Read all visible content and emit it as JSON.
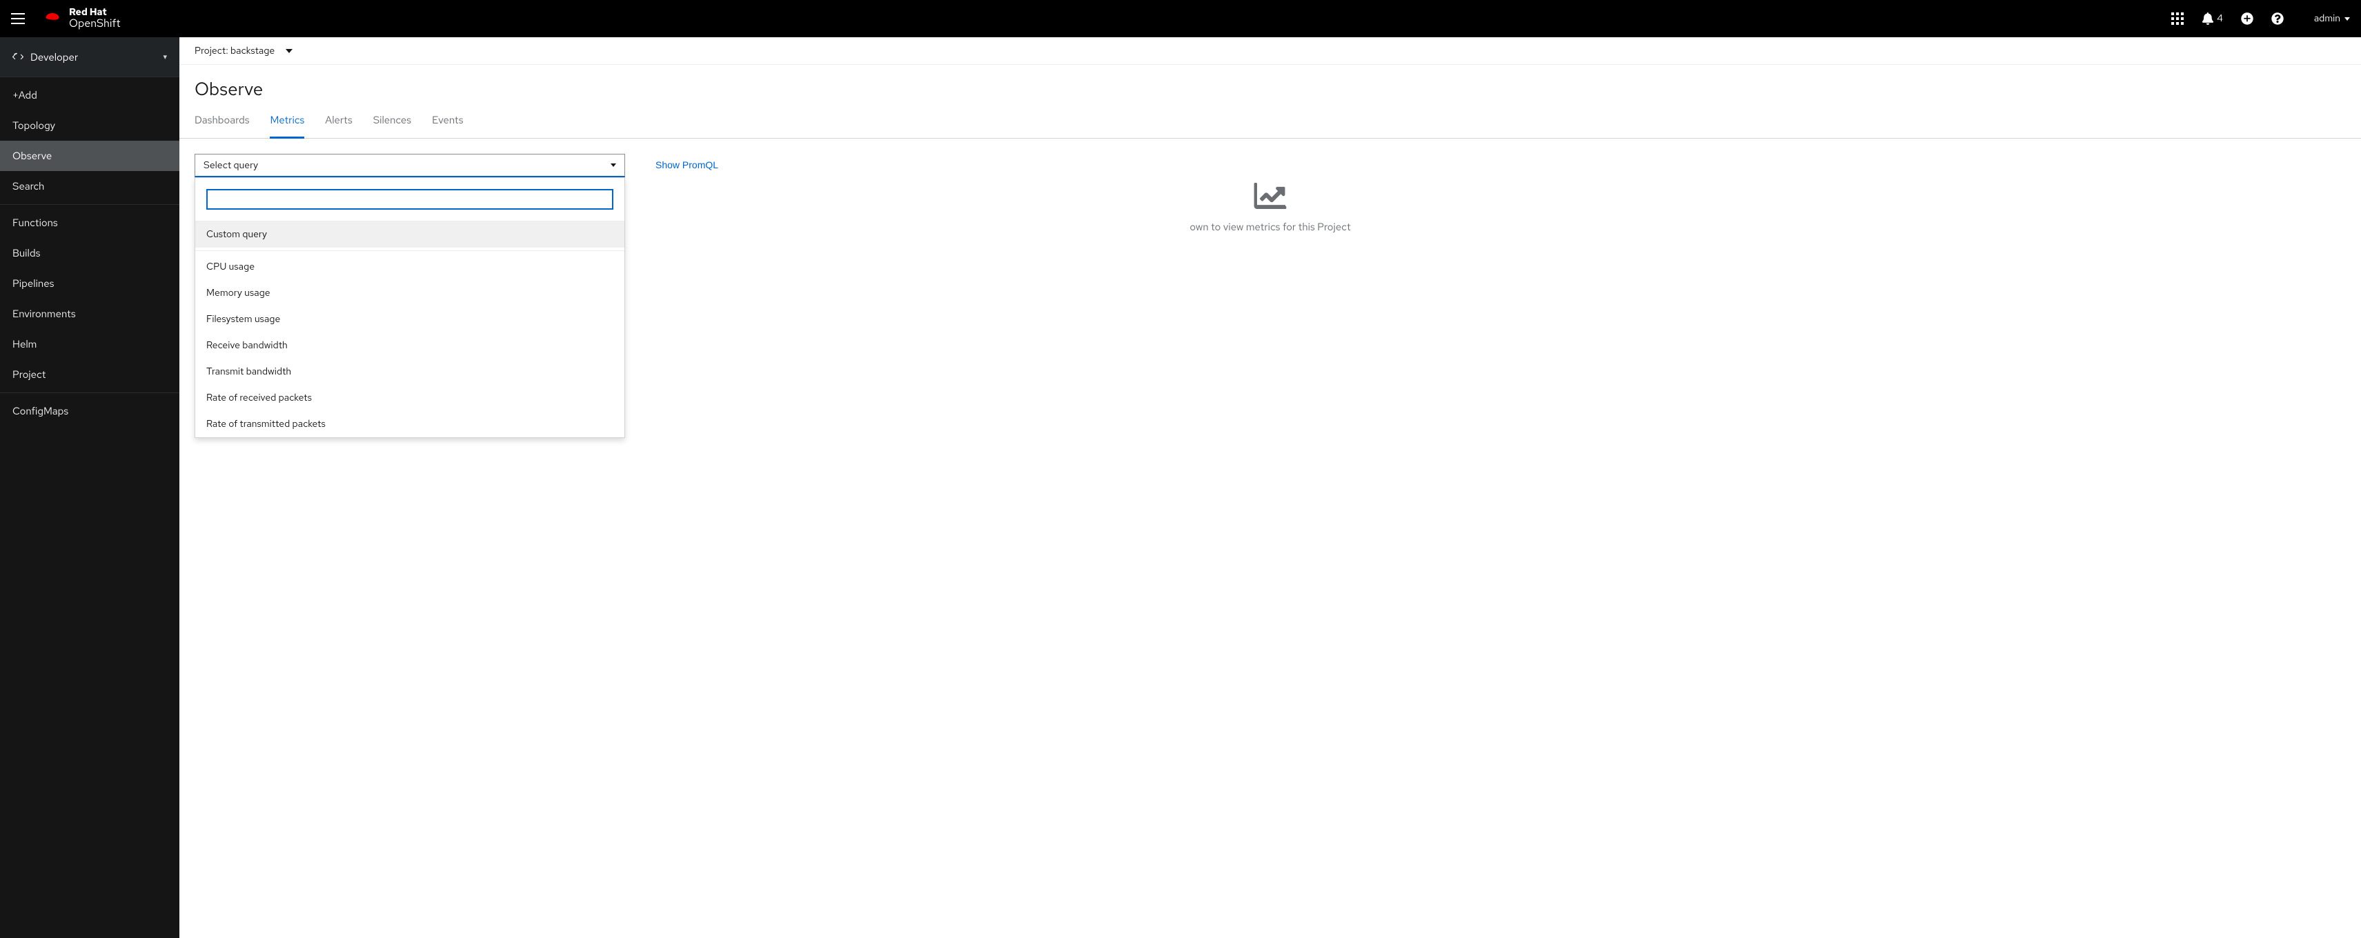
{
  "brand": {
    "line1": "Red Hat",
    "line2": "OpenShift"
  },
  "masthead": {
    "notification_count": "4",
    "user": "admin"
  },
  "perspective": {
    "label": "Developer"
  },
  "sidebar": {
    "group1": [
      {
        "label": "+Add"
      },
      {
        "label": "Topology"
      },
      {
        "label": "Observe"
      },
      {
        "label": "Search"
      }
    ],
    "group2": [
      {
        "label": "Functions"
      },
      {
        "label": "Builds"
      },
      {
        "label": "Pipelines"
      },
      {
        "label": "Environments"
      },
      {
        "label": "Helm"
      },
      {
        "label": "Project"
      }
    ],
    "group3": [
      {
        "label": "ConfigMaps"
      }
    ]
  },
  "project_bar": {
    "label": "Project: backstage"
  },
  "page": {
    "title": "Observe"
  },
  "tabs": [
    {
      "label": "Dashboards"
    },
    {
      "label": "Metrics"
    },
    {
      "label": "Alerts"
    },
    {
      "label": "Silences"
    },
    {
      "label": "Events"
    }
  ],
  "query": {
    "select_label": "Select query",
    "show_promql": "Show PromQL",
    "search_value": "",
    "options_top": [
      {
        "label": "Custom query"
      }
    ],
    "options": [
      {
        "label": "CPU usage"
      },
      {
        "label": "Memory usage"
      },
      {
        "label": "Filesystem usage"
      },
      {
        "label": "Receive bandwidth"
      },
      {
        "label": "Transmit bandwidth"
      },
      {
        "label": "Rate of received packets"
      },
      {
        "label": "Rate of transmitted packets"
      }
    ]
  },
  "empty": {
    "hint_suffix": "own to view metrics for this Project"
  }
}
